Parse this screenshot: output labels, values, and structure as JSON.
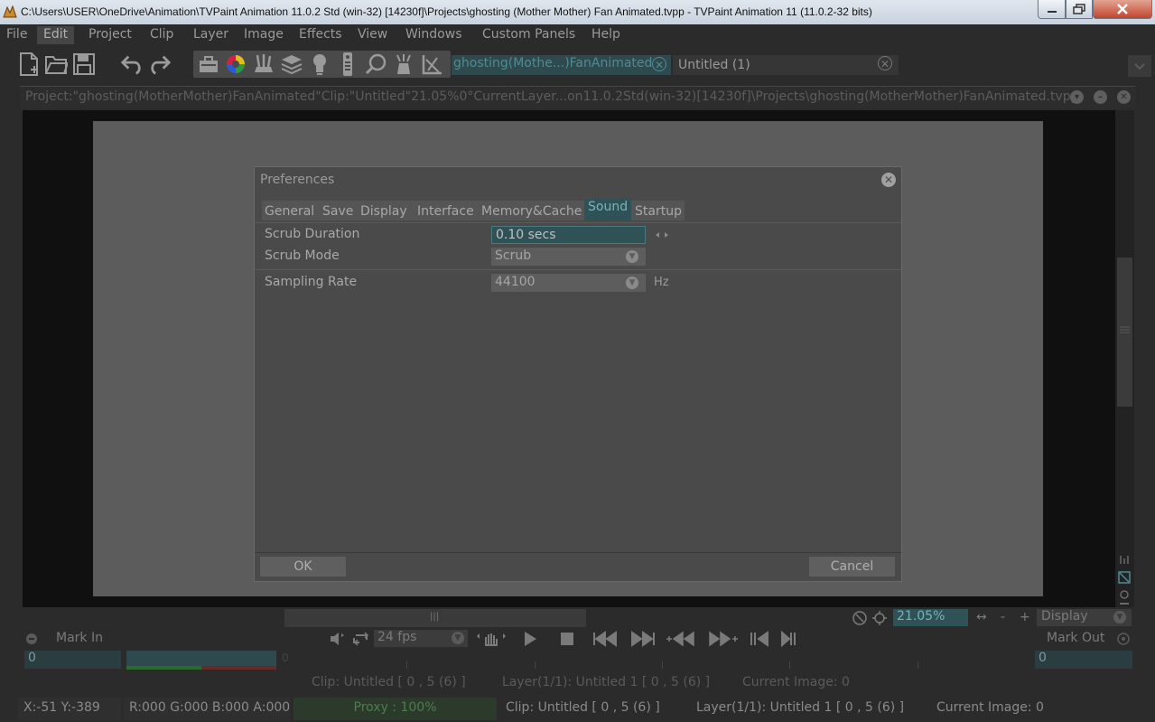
{
  "window": {
    "title": "C:\\Users\\USER\\OneDrive\\Animation\\TVPaint Animation 11.0.2 Std (win-32) [14230f]\\Projects\\ghosting (Mother Mother) Fan Animated.tvpp - TVPaint Animation 11 (11.0.2-32 bits)"
  },
  "menu": [
    "File",
    "Edit",
    "Project",
    "Clip",
    "Layer",
    "Image",
    "Effects",
    "View",
    "Windows",
    "Custom Panels",
    "Help"
  ],
  "menu_active": "Edit",
  "doc_tabs": [
    {
      "label": "ghosting(Mothe...)FanAnimated",
      "active": true
    },
    {
      "label": "Untitled (1)",
      "active": false
    }
  ],
  "project_bar": "Project:\"ghosting(MotherMother)FanAnimated\"Clip:\"Untitled\"21.05%0°CurrentLayer...on11.0.2Std(win-32)[14230f]\\Projects\\ghosting(MotherMother)FanAnimated.tvpp",
  "dialog": {
    "title": "Preferences",
    "tabs": [
      "General",
      "Save",
      "Display",
      "Interface",
      "Memory&Cache",
      "Sound",
      "Startup"
    ],
    "active_tab": "Sound",
    "rows": {
      "scrub_duration": {
        "label": "Scrub Duration",
        "value": "0.10 secs"
      },
      "scrub_mode": {
        "label": "Scrub Mode",
        "value": "Scrub"
      },
      "sampling_rate": {
        "label": "Sampling Rate",
        "value": "44100",
        "unit": "Hz"
      }
    },
    "ok_label": "OK",
    "cancel_label": "Cancel"
  },
  "view": {
    "zoom": "21.05%",
    "display": "Display",
    "minus": "-",
    "plus": "+"
  },
  "transport": {
    "mark_in_label": "Mark In",
    "mark_out_label": "Mark Out",
    "fps": "24 fps",
    "mark_in_value": "0",
    "mark_out_value": "0",
    "timeline_zero": "0"
  },
  "info": {
    "clip": "Clip: Untitled [ 0 , 5  (6) ]",
    "layer": "Layer(1/1): Untitled 1 [ 0 , 5  (6) ]",
    "current_image": "Current Image: 0"
  },
  "status": {
    "coords": "X:-51  Y:-389",
    "rgba": "R:000 G:000 B:000 A:000",
    "proxy": "Proxy : 100%",
    "clip": "Clip: Untitled [ 0 , 5  (6) ]",
    "layer": "Layer(1/1): Untitled 1 [ 0 , 5  (6) ]",
    "current_image": "Current Image: 0"
  }
}
